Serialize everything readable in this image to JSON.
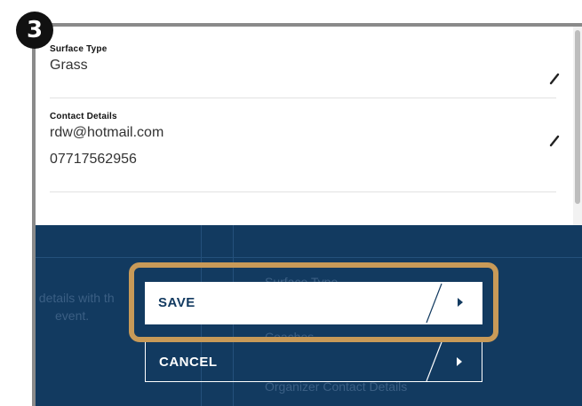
{
  "step_badge": "3",
  "surface": {
    "label": "Surface Type",
    "value": "Grass"
  },
  "contact": {
    "label": "Contact Details",
    "email": "rdw@hotmail.com",
    "phone": "07717562956"
  },
  "background": {
    "left_line1": "t details with th",
    "left_line2": "event.",
    "item1": "Surface Type",
    "item2": "Coaches",
    "item3": "Organizer Contact Details"
  },
  "actions": {
    "save_label": "SAVE",
    "cancel_label": "CANCEL"
  },
  "colors": {
    "navy": "#123a60",
    "callout": "#c89a58",
    "badge": "#111111"
  },
  "icons": {
    "edit": "pencil-icon",
    "next": "caret-right-icon"
  }
}
